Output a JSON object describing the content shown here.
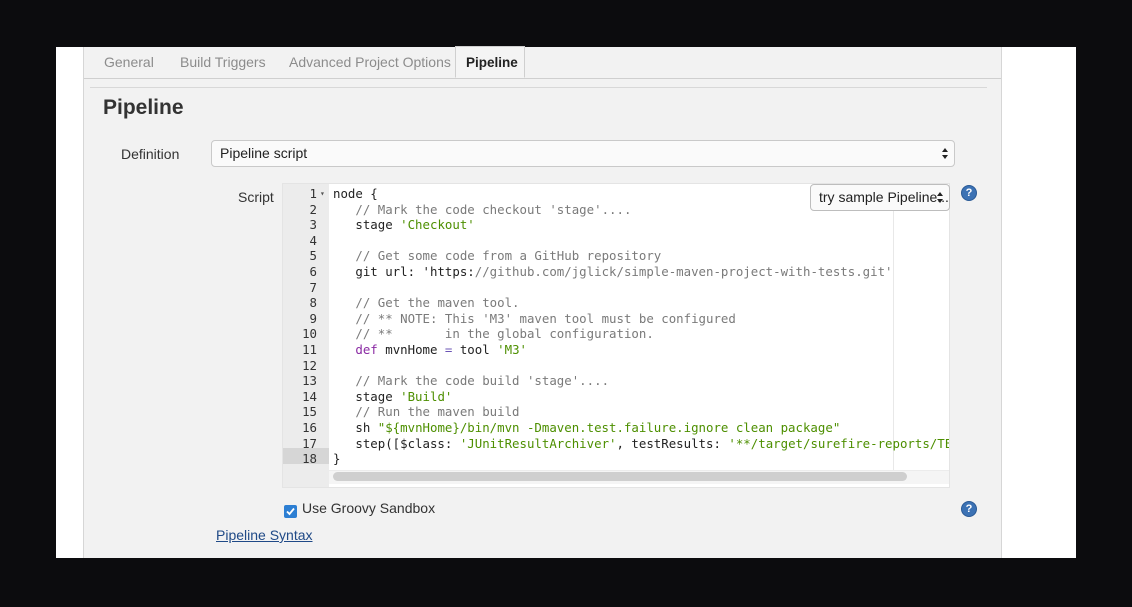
{
  "tabs": [
    {
      "label": "General"
    },
    {
      "label": "Build Triggers"
    },
    {
      "label": "Advanced Project Options"
    },
    {
      "label": "Pipeline"
    }
  ],
  "section": {
    "title": "Pipeline"
  },
  "definition": {
    "label": "Definition",
    "value": "Pipeline script"
  },
  "script": {
    "label": "Script",
    "sample_select": "try sample Pipeline...",
    "lines": [
      {
        "n": "1",
        "text": "node {"
      },
      {
        "n": "2",
        "text": "   // Mark the code checkout 'stage'...."
      },
      {
        "n": "3",
        "text": "   stage 'Checkout'"
      },
      {
        "n": "4",
        "text": ""
      },
      {
        "n": "5",
        "text": "   // Get some code from a GitHub repository"
      },
      {
        "n": "6",
        "text": "   git url: 'https://github.com/jglick/simple-maven-project-with-tests.git'"
      },
      {
        "n": "7",
        "text": ""
      },
      {
        "n": "8",
        "text": "   // Get the maven tool."
      },
      {
        "n": "9",
        "text": "   // ** NOTE: This 'M3' maven tool must be configured"
      },
      {
        "n": "10",
        "text": "   // **       in the global configuration."
      },
      {
        "n": "11",
        "text": "   def mvnHome = tool 'M3'"
      },
      {
        "n": "12",
        "text": ""
      },
      {
        "n": "13",
        "text": "   // Mark the code build 'stage'...."
      },
      {
        "n": "14",
        "text": "   stage 'Build'"
      },
      {
        "n": "15",
        "text": "   // Run the maven build"
      },
      {
        "n": "16",
        "text": "   sh \"${mvnHome}/bin/mvn -Dmaven.test.failure.ignore clean package\""
      },
      {
        "n": "17",
        "text": "   step([$class: 'JUnitResultArchiver', testResults: '**/target/surefire-reports/TEST-*.."
      },
      {
        "n": "18",
        "text": "}"
      }
    ]
  },
  "sandbox": {
    "label": "Use Groovy Sandbox",
    "checked": true
  },
  "syntax_link": "Pipeline Syntax",
  "help_icon": "?",
  "colors": {
    "accent": "#3c72b4",
    "string": "#4d8f00",
    "comment": "#7a7a7a",
    "keyword": "#8a2aa3"
  }
}
